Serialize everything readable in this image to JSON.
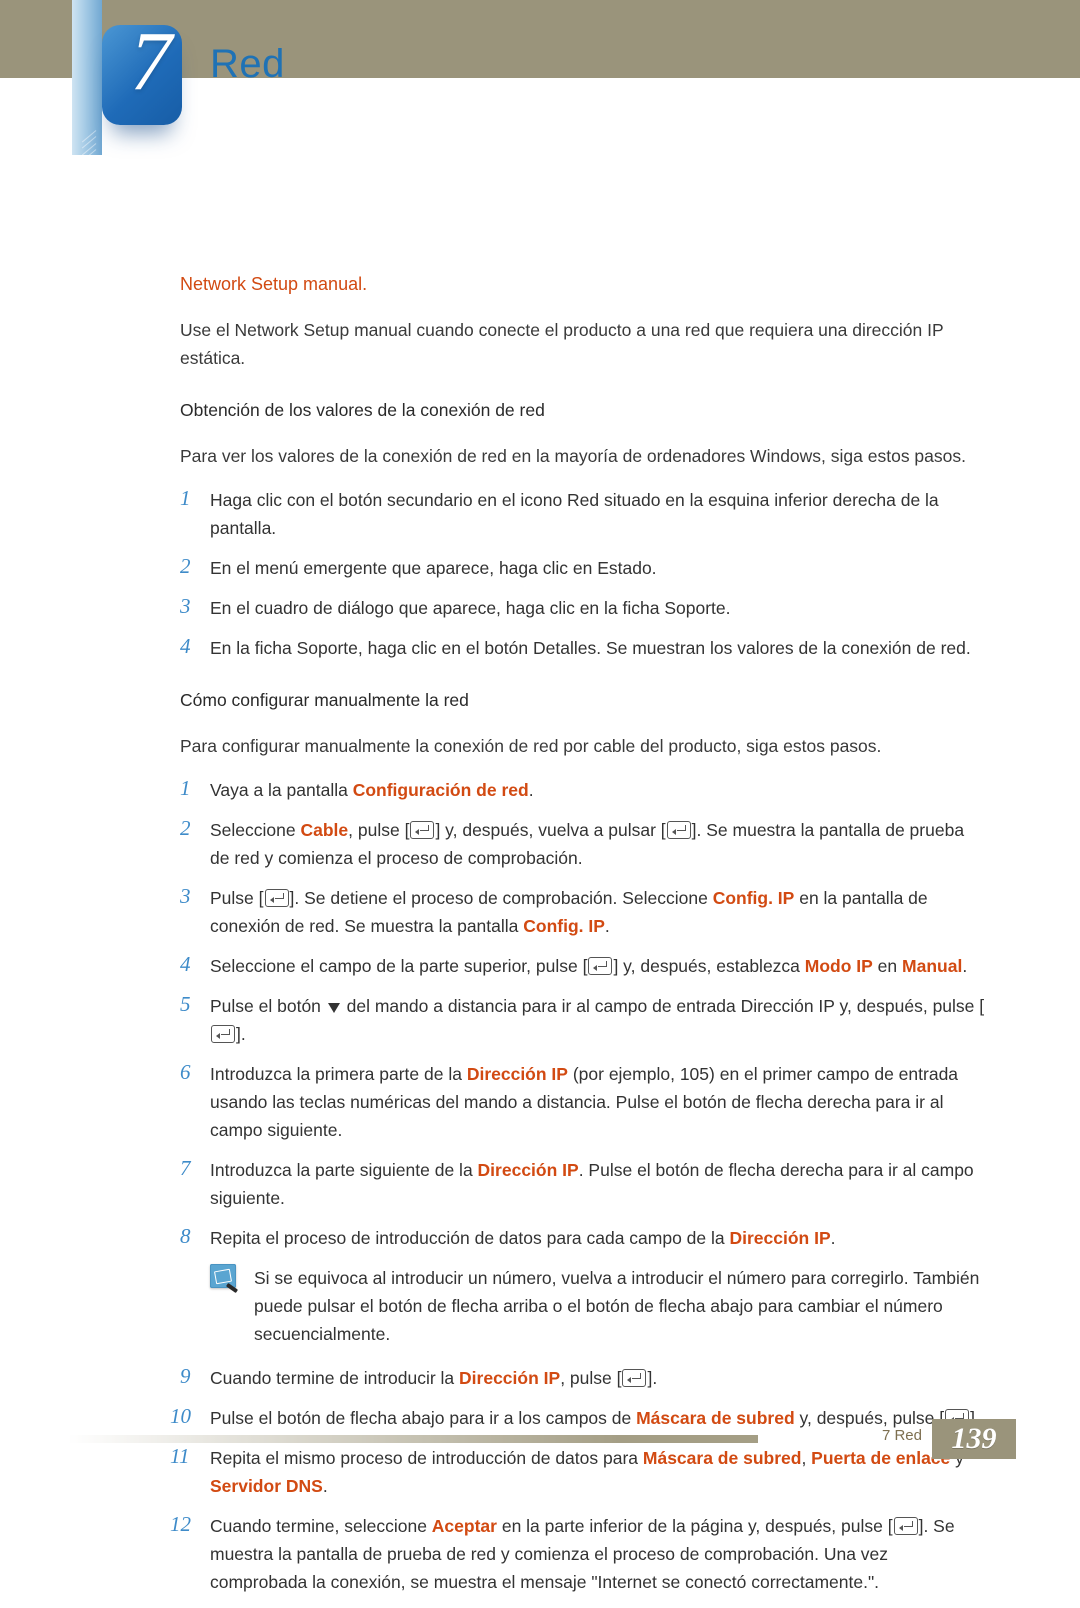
{
  "chapter": {
    "number": "7",
    "title": "Red"
  },
  "section": {
    "heading_red": "Network Setup manual.",
    "intro": "Use el Network Setup manual cuando conecte el producto a una red que requiera una dirección IP estática.",
    "sub1_heading": "Obtención de los valores de la conexión de red",
    "sub1_intro": "Para ver los valores de la conexión de red en la mayoría de ordenadores Windows, siga estos pasos.",
    "sub1_steps": [
      "Haga clic con el botón secundario en el icono Red situado en la esquina inferior derecha de la pantalla.",
      "En el menú emergente que aparece, haga clic en Estado.",
      "En el cuadro de diálogo que aparece, haga clic en la ficha Soporte.",
      "En la ficha Soporte, haga clic en el botón Detalles. Se muestran los valores de la conexión de red."
    ],
    "sub2_heading": "Cómo configurar manualmente la red",
    "sub2_intro": "Para configurar manualmente la conexión de red por cable del producto, siga estos pasos.",
    "steps2": {
      "s1": {
        "a": "Vaya a la pantalla ",
        "b": "Configuración de red",
        "c": "."
      },
      "s2": {
        "a": "Seleccione ",
        "b": "Cable",
        "c": ", pulse [",
        "d": "] y, después, vuelva a pulsar [",
        "e": "]. Se muestra la pantalla de prueba de red y comienza el proceso de comprobación."
      },
      "s3": {
        "a": "Pulse [",
        "b": "]. Se detiene el proceso de comprobación. Seleccione ",
        "c": "Config. IP",
        "d": " en la pantalla de conexión de red. Se muestra la pantalla ",
        "e": "Config. IP",
        "f": "."
      },
      "s4": {
        "a": "Seleccione el campo de la parte superior, pulse [",
        "b": "] y, después, establezca ",
        "c": "Modo IP",
        "d": " en ",
        "e": "Manual",
        "f": "."
      },
      "s5": {
        "a": "Pulse el botón ",
        "b": " del mando a distancia para ir al campo de entrada Dirección IP y, después, pulse [",
        "c": "]."
      },
      "s6": {
        "a": "Introduzca la primera parte de la ",
        "b": "Dirección IP",
        "c": " (por ejemplo, 105) en el primer campo de entrada usando las teclas numéricas del mando a distancia. Pulse el botón de flecha derecha para ir al campo siguiente."
      },
      "s7": {
        "a": "Introduzca la parte siguiente de la ",
        "b": "Dirección IP",
        "c": ". Pulse el botón de flecha derecha para ir al campo siguiente."
      },
      "s8": {
        "a": "Repita el proceso de introducción de datos para cada campo de la ",
        "b": "Dirección IP",
        "c": "."
      },
      "note": "Si se equivoca al introducir un número, vuelva a introducir el número para corregirlo. También puede pulsar el botón de flecha arriba o el botón de flecha abajo para cambiar el número secuencialmente.",
      "s9": {
        "a": "Cuando termine de introducir la ",
        "b": "Dirección IP",
        "c": ", pulse [",
        "d": "]."
      },
      "s10": {
        "a": "Pulse el botón de flecha abajo para ir a los campos de ",
        "b": "Máscara de subred",
        "c": " y, después, pulse [",
        "d": "]."
      },
      "s11": {
        "a": "Repita el mismo proceso de introducción de datos para ",
        "b": "Máscara de subred",
        "c": ", ",
        "d": "Puerta de enlace",
        "e": " y ",
        "f": "Servidor DNS",
        "g": "."
      },
      "s12": {
        "a": "Cuando termine, seleccione ",
        "b": "Aceptar",
        "c": " en la parte inferior de la página y, después, pulse [",
        "d": "]. Se muestra la pantalla de prueba de red y comienza el proceso de comprobación. Una vez comprobada la conexión, se muestra el mensaje \"Internet se conectó correctamente.\"."
      }
    }
  },
  "numbers": {
    "n1": "1",
    "n2": "2",
    "n3": "3",
    "n4": "4",
    "n5": "5",
    "n6": "6",
    "n7": "7",
    "n8": "8",
    "n9": "9",
    "n10": "10",
    "n11": "11",
    "n12": "12"
  },
  "footer": {
    "chapter_label": "7 Red",
    "page": "139"
  }
}
